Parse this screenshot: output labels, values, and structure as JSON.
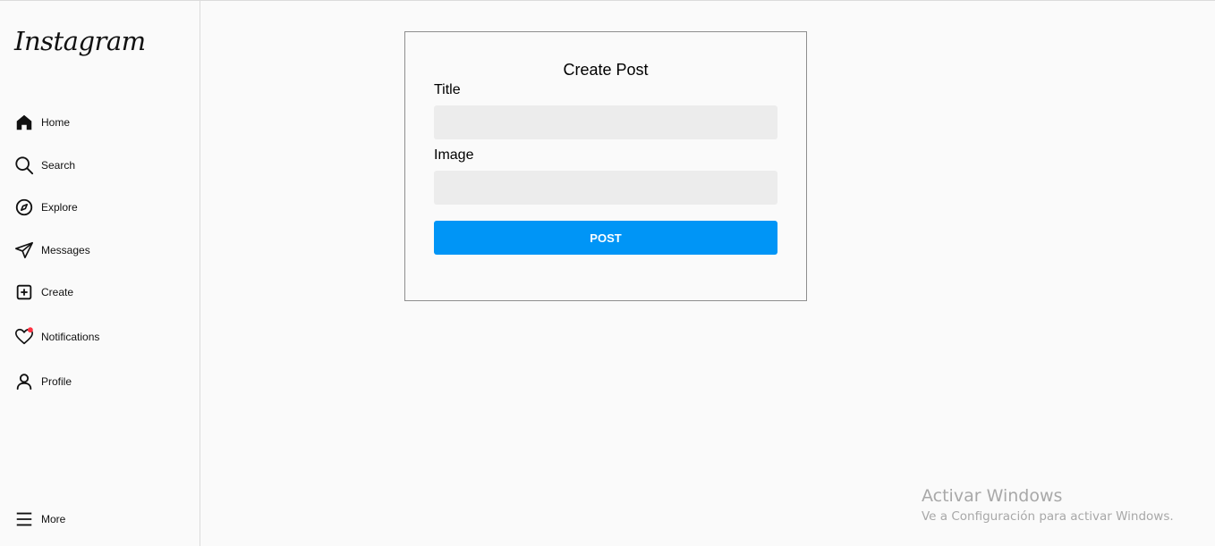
{
  "sidebar": {
    "logo": "Instagram",
    "items": [
      {
        "label": "Home",
        "icon": "home-icon"
      },
      {
        "label": "Search",
        "icon": "search-icon"
      },
      {
        "label": "Explore",
        "icon": "compass-icon"
      },
      {
        "label": "Messages",
        "icon": "paper-plane-icon"
      },
      {
        "label": "Create",
        "icon": "plus-square-icon"
      },
      {
        "label": "Notifications",
        "icon": "heart-icon"
      },
      {
        "label": "Profile",
        "icon": "user-icon"
      }
    ],
    "more": {
      "label": "More",
      "icon": "menu-icon"
    }
  },
  "form": {
    "title": "Create Post",
    "title_label": "Title",
    "title_value": "",
    "image_label": "Image",
    "image_value": "",
    "submit_label": "POST"
  },
  "watermark": {
    "title": "Activar Windows",
    "subtitle": "Ve a Configuración para activar Windows."
  },
  "colors": {
    "accent": "#0095f6",
    "notification_dot": "#ff3040",
    "input_bg": "#ececec",
    "background": "#fafafa"
  }
}
